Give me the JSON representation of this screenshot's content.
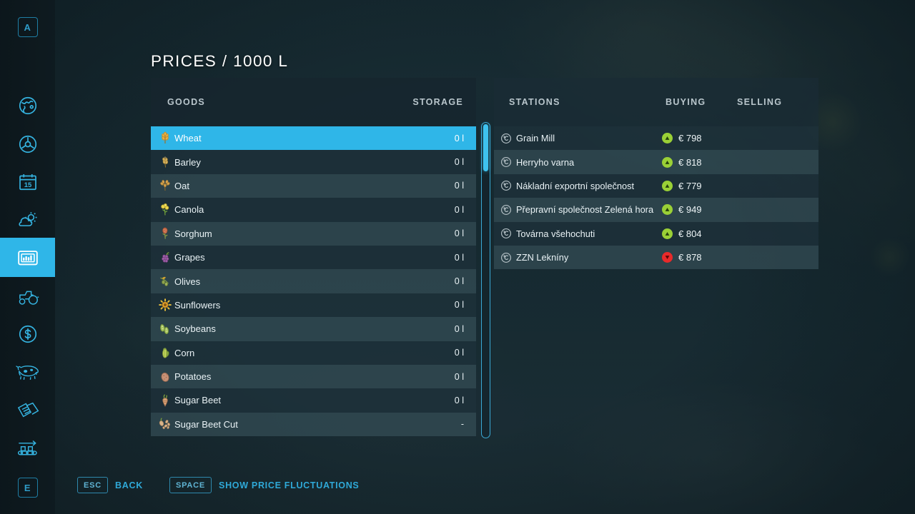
{
  "title": "PRICES / 1000 L",
  "sidebar": {
    "top_key": "A",
    "bottom_key": "E",
    "items": [
      {
        "name": "map-icon",
        "label": "Map"
      },
      {
        "name": "vehicle-icon",
        "label": "Vehicles"
      },
      {
        "name": "calendar-icon",
        "label": "Calendar",
        "day": "15"
      },
      {
        "name": "weather-icon",
        "label": "Weather"
      },
      {
        "name": "prices-icon",
        "label": "Prices",
        "selected": true
      },
      {
        "name": "tractor-icon",
        "label": "Machines"
      },
      {
        "name": "finances-icon",
        "label": "Finances"
      },
      {
        "name": "animals-icon",
        "label": "Animals"
      },
      {
        "name": "contracts-icon",
        "label": "Contracts"
      },
      {
        "name": "production-icon",
        "label": "Production"
      }
    ]
  },
  "goods_panel": {
    "col_goods": "GOODS",
    "col_storage": "STORAGE",
    "rows": [
      {
        "icon": "wheat-icon",
        "label": "Wheat",
        "storage": "0 l",
        "selected": true
      },
      {
        "icon": "barley-icon",
        "label": "Barley",
        "storage": "0 l"
      },
      {
        "icon": "oat-icon",
        "label": "Oat",
        "storage": "0 l"
      },
      {
        "icon": "canola-icon",
        "label": "Canola",
        "storage": "0 l"
      },
      {
        "icon": "sorghum-icon",
        "label": "Sorghum",
        "storage": "0 l"
      },
      {
        "icon": "grapes-icon",
        "label": "Grapes",
        "storage": "0 l"
      },
      {
        "icon": "olives-icon",
        "label": "Olives",
        "storage": "0 l"
      },
      {
        "icon": "sunflowers-icon",
        "label": "Sunflowers",
        "storage": "0 l"
      },
      {
        "icon": "soybeans-icon",
        "label": "Soybeans",
        "storage": "0 l"
      },
      {
        "icon": "corn-icon",
        "label": "Corn",
        "storage": "0 l"
      },
      {
        "icon": "potatoes-icon",
        "label": "Potatoes",
        "storage": "0 l"
      },
      {
        "icon": "sugarbeet-icon",
        "label": "Sugar Beet",
        "storage": "0 l"
      },
      {
        "icon": "sugarbeetcut-icon",
        "label": "Sugar Beet Cut",
        "storage": "-"
      }
    ]
  },
  "stations_panel": {
    "col_stations": "STATIONS",
    "col_buying": "BUYING",
    "col_selling": "SELLING",
    "rows": [
      {
        "icon": "station-icon",
        "label": "Grain Mill",
        "trend": "up",
        "buying": "€ 798",
        "selling": ""
      },
      {
        "icon": "station-icon",
        "label": "Herryho varna",
        "trend": "up",
        "buying": "€ 818",
        "selling": ""
      },
      {
        "icon": "station-icon",
        "label": "Nákladní exportní společnost",
        "trend": "up",
        "buying": "€ 779",
        "selling": ""
      },
      {
        "icon": "station-icon",
        "label": "Přepravní společnost Zelená hora",
        "trend": "up",
        "buying": "€ 949",
        "selling": ""
      },
      {
        "icon": "station-icon",
        "label": "Továrna všehochuti",
        "trend": "up",
        "buying": "€ 804",
        "selling": ""
      },
      {
        "icon": "station-icon",
        "label": "ZZN Lekníny",
        "trend": "down",
        "buying": "€ 878",
        "selling": ""
      }
    ]
  },
  "hints": [
    {
      "key": "ESC",
      "label": "BACK"
    },
    {
      "key": "SPACE",
      "label": "SHOW PRICE FLUCTUATIONS"
    }
  ],
  "colors": {
    "accent": "#2fb6e8",
    "trend_up": "#9ad036",
    "trend_down": "#e82a2a",
    "panel_dark": "#1e323b",
    "panel_light": "#344e56"
  }
}
